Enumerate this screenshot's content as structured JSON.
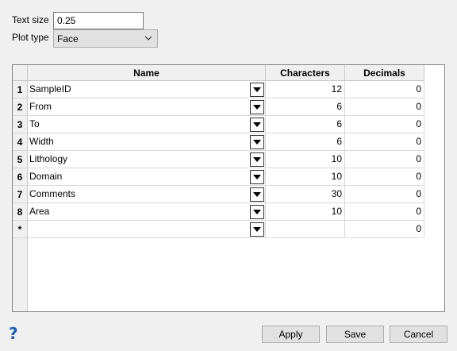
{
  "form": {
    "text_size_label": "Text size",
    "text_size_value": "0.25",
    "plot_type_label": "Plot type",
    "plot_type_value": "Face"
  },
  "table": {
    "headers": {
      "name": "Name",
      "characters": "Characters",
      "decimals": "Decimals"
    },
    "rows": [
      {
        "index": "1",
        "name": "SampleID",
        "characters": "12",
        "decimals": "0"
      },
      {
        "index": "2",
        "name": "From",
        "characters": "6",
        "decimals": "0"
      },
      {
        "index": "3",
        "name": "To",
        "characters": "6",
        "decimals": "0"
      },
      {
        "index": "4",
        "name": "Width",
        "characters": "6",
        "decimals": "0"
      },
      {
        "index": "5",
        "name": "Lithology",
        "characters": "10",
        "decimals": "0"
      },
      {
        "index": "6",
        "name": "Domain",
        "characters": "10",
        "decimals": "0"
      },
      {
        "index": "7",
        "name": "Comments",
        "characters": "30",
        "decimals": "0"
      },
      {
        "index": "8",
        "name": "Area",
        "characters": "10",
        "decimals": "0"
      },
      {
        "index": "*",
        "name": "",
        "characters": "",
        "decimals": "0"
      }
    ]
  },
  "footer": {
    "help_glyph": "?",
    "apply_label": "Apply",
    "save_label": "Save",
    "cancel_label": "Cancel"
  },
  "icons": {
    "dropdown": "chevron-down-icon",
    "cell_dropdown": "triangle-down-icon",
    "help": "question-mark-icon"
  },
  "colors": {
    "help": "#1c5fb8",
    "window_bg": "#f0f0f0"
  }
}
